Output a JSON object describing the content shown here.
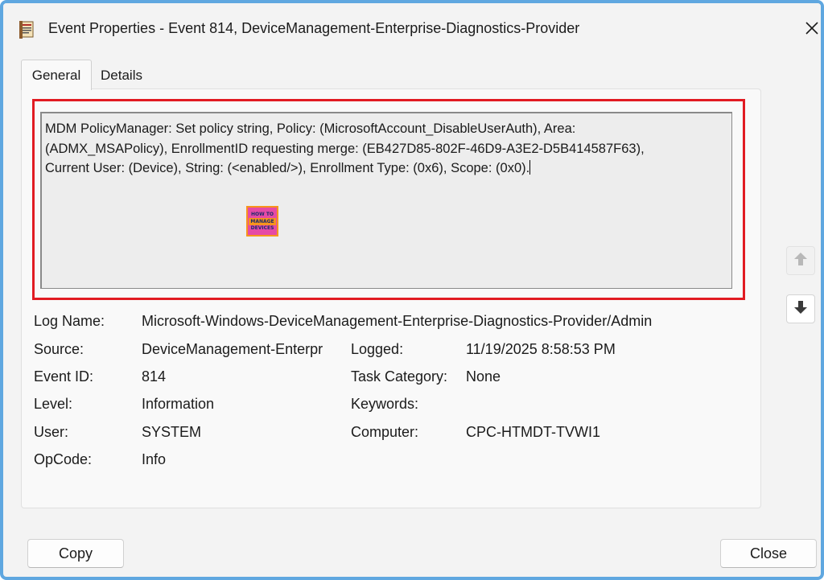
{
  "window": {
    "title": "Event Properties - Event 814, DeviceManagement-Enterprise-Diagnostics-Provider",
    "icon": "event-viewer-icon",
    "close_icon": "close-icon"
  },
  "tabs": [
    {
      "label": "General",
      "selected": true
    },
    {
      "label": "Details",
      "selected": false
    }
  ],
  "description": {
    "lines": [
      "MDM PolicyManager: Set policy string, Policy: (MicrosoftAccount_DisableUserAuth), Area:",
      "(ADMX_MSAPolicy), EnrollmentID requesting merge: (EB427D85-802F-46D9-A3E2-D5B414587F63),",
      "Current User: (Device), String: (<enabled/>), Enrollment Type: (0x6), Scope: (0x0)."
    ]
  },
  "watermark": {
    "line1": "HOW TO",
    "line2": "MANAGE",
    "line3": "DEVICES"
  },
  "nav": {
    "up_icon": "arrow-up-icon",
    "down_icon": "arrow-down-icon"
  },
  "fields": {
    "log_name_label": "Log Name:",
    "log_name_value": "Microsoft-Windows-DeviceManagement-Enterprise-Diagnostics-Provider/Admin",
    "source_label": "Source:",
    "source_value": "DeviceManagement-Enterpr",
    "logged_label": "Logged:",
    "logged_value": "11/19/2025 8:58:53 PM",
    "event_id_label": "Event ID:",
    "event_id_value": "814",
    "task_category_label": "Task Category:",
    "task_category_value": "None",
    "level_label": "Level:",
    "level_value": "Information",
    "keywords_label": "Keywords:",
    "keywords_value": "",
    "user_label": "User:",
    "user_value": "SYSTEM",
    "computer_label": "Computer:",
    "computer_value": "CPC-HTMDT-TVWI1",
    "opcode_label": "OpCode:",
    "opcode_value": "Info"
  },
  "buttons": {
    "copy": "Copy",
    "close": "Close"
  },
  "colors": {
    "highlight_border": "#e11b22",
    "window_border": "#5fa7e0"
  }
}
